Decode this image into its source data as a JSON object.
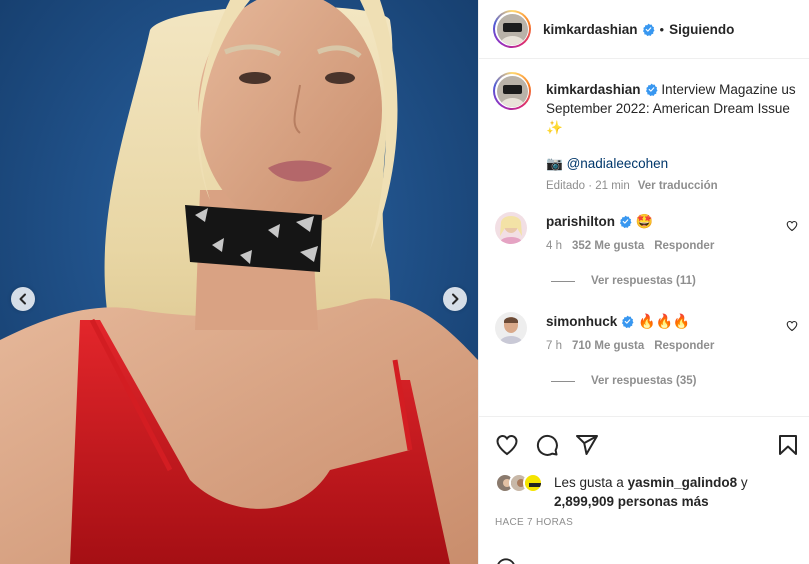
{
  "post": {
    "username": "kimkardashian",
    "follow_status": "Siguiendo",
    "separator": "•"
  },
  "caption": {
    "username": "kimkardashian",
    "text": "Interview Magazine us September 2022: American Dream Issue",
    "sparkle_emoji": "✨",
    "camera_emoji": "📷",
    "mention": "@nadialeecohen",
    "edited_time": "Editado · 21 min",
    "see_translation": "Ver traducción"
  },
  "comments": [
    {
      "username": "parishilton",
      "text": "🤩",
      "time": "4 h",
      "likes": "352 Me gusta",
      "reply": "Responder",
      "view_replies": "Ver respuestas (11)"
    },
    {
      "username": "simonhuck",
      "text": "🔥🔥🔥",
      "time": "7 h",
      "likes": "710 Me gusta",
      "reply": "Responder",
      "view_replies": "Ver respuestas (35)"
    }
  ],
  "likes": {
    "prefix": "Les gusta a",
    "user": "yasmin_galindo8",
    "connector": "y",
    "count": "2,899,909 personas más"
  },
  "timestamp": "HACE 7 HORAS",
  "icons": {
    "like": "heart-icon",
    "comment": "comment-icon",
    "share": "share-icon",
    "save": "bookmark-icon",
    "prev": "chevron-left-icon",
    "next": "chevron-right-icon",
    "verified": "verified-badge-icon"
  },
  "colors": {
    "verified": "#3897f0",
    "link": "#00376b",
    "muted": "#8e8e8e",
    "text": "#262626"
  }
}
